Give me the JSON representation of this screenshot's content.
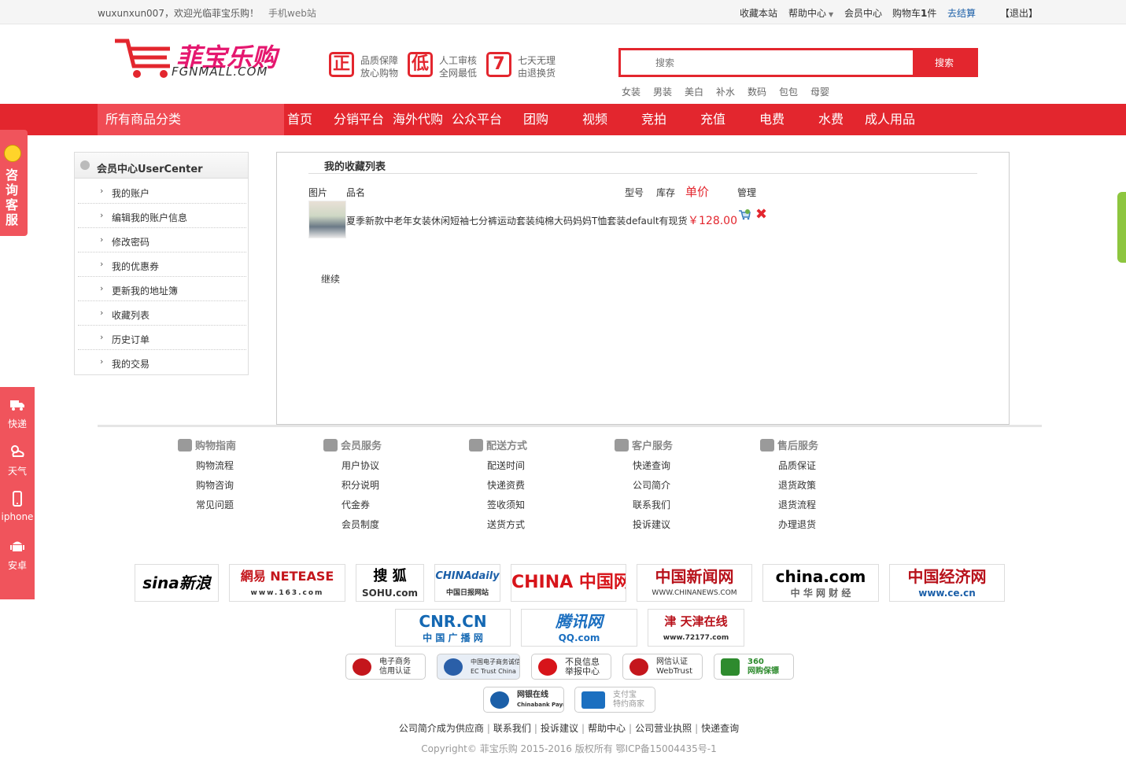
{
  "topbar": {
    "welcome": "wuxunxun007，欢迎光临菲宝乐购！",
    "mobile": "手机web站",
    "favorites": "收藏本站",
    "help": "帮助中心",
    "member": "会员中心",
    "cart_prefix": "购物车",
    "cart_count": "1",
    "cart_suffix": "件",
    "checkout": "去结算",
    "logout": "【退出】"
  },
  "logo": {
    "cn": "菲宝乐购",
    "en": "FGNMALL.COM"
  },
  "promises": [
    {
      "icon": "正",
      "line1": "品质保障",
      "line2": "放心购物"
    },
    {
      "icon": "低",
      "line1": "人工审核",
      "line2": "全网最低"
    },
    {
      "icon": "7",
      "line1": "七天无理",
      "line2": "由退换货"
    }
  ],
  "search": {
    "placeholder": "搜索",
    "button": "搜索"
  },
  "hotwords": [
    "女装",
    "男装",
    "美白",
    "补水",
    "数码",
    "包包",
    "母婴"
  ],
  "nav": {
    "all_categories": "所有商品分类",
    "items": [
      "首页",
      "分销平台",
      "海外代购",
      "公众平台",
      "团购",
      "视频",
      "竞拍",
      "充值",
      "电费",
      "水费",
      "成人用品"
    ]
  },
  "consult": {
    "label": "咨询客服"
  },
  "sidetools": [
    {
      "icon": "truck-icon",
      "label": "快递"
    },
    {
      "icon": "weather-icon",
      "label": "天气"
    },
    {
      "icon": "phone-icon",
      "label": "iphone"
    },
    {
      "icon": "android-icon",
      "label": "安卓"
    }
  ],
  "usercenter": {
    "title": "会员中心UserCenter",
    "items": [
      "我的账户",
      "编辑我的账户信息",
      "修改密码",
      "我的优惠券",
      "更新我的地址簿",
      "收藏列表",
      "历史订单",
      "我的交易"
    ]
  },
  "favorites": {
    "title": "我的收藏列表",
    "columns": {
      "image": "图片",
      "name": "品名",
      "model": "型号",
      "stock": "库存",
      "price": "单价",
      "manage": "管理"
    },
    "items": [
      {
        "name": "夏季新款中老年女装休闲短袖七分裤运动套装纯棉大码妈妈T恤套装default有现货",
        "price": "￥128.00"
      }
    ],
    "continue": "继续"
  },
  "footer": {
    "columns": [
      {
        "title": "购物指南",
        "links": [
          "购物流程",
          "购物咨询",
          "常见问题"
        ]
      },
      {
        "title": "会员服务",
        "links": [
          "用户协议",
          "积分说明",
          "代金券",
          "会员制度"
        ]
      },
      {
        "title": "配送方式",
        "links": [
          "配送时间",
          "快递资费",
          "签收须知",
          "送货方式"
        ]
      },
      {
        "title": "客户服务",
        "links": [
          "快递查询",
          "公司简介",
          "联系我们",
          "投诉建议"
        ]
      },
      {
        "title": "售后服务",
        "links": [
          "品质保证",
          "退货政策",
          "退货流程",
          "办理退货"
        ]
      }
    ],
    "media_logos": [
      {
        "main": "sina新浪",
        "sub": "",
        "color": "#000000"
      },
      {
        "main": "網易 NETEASE",
        "sub": "www.163.com",
        "color": "#c4161c"
      },
      {
        "main": "搜 狐",
        "sub": "SOHU.com",
        "color": "#000000"
      },
      {
        "main": "CHINAdaily",
        "sub": "中国日报网站",
        "color": "#1b5fa8"
      },
      {
        "main": "CHINA 中国网",
        "sub": "",
        "color": "#d7141a"
      },
      {
        "main": "中国新闻网",
        "sub": "WWW.CHINANEWS.COM",
        "color": "#b8121b"
      },
      {
        "main": "china.com",
        "sub": "中 华 网 财 经",
        "color": "#000000"
      },
      {
        "main": "中国经济网",
        "sub": "www.ce.cn",
        "color": "#b8121b"
      },
      {
        "main": "CNR.CN",
        "sub": "中 国 广 播 网",
        "color": "#1468b3"
      },
      {
        "main": "腾讯网",
        "sub": "QQ.com",
        "color": "#1b6fc0"
      },
      {
        "main": "津 天津在线",
        "sub": "www.72177.com",
        "color": "#b8121b"
      }
    ],
    "badges": [
      {
        "line1": "电子商务",
        "line2": "信用认证",
        "color": "#c4161c"
      },
      {
        "line1": "中国电子商务诚信单位",
        "line2": "EC Trust China",
        "color": "#2a5fa8"
      },
      {
        "line1": "不良信息",
        "line2": "举报中心",
        "color": "#d7141a"
      },
      {
        "line1": "网信认证",
        "line2": "WebTrust",
        "color": "#c4161c"
      },
      {
        "line1": "360",
        "line2": "网购保镖",
        "color": "#2e8b2e"
      },
      {
        "line1": "网银在线",
        "line2": "Chinabank Payment",
        "color": "#1b5fa8"
      },
      {
        "line1": "支付宝",
        "line2": "特约商家",
        "color": "#1b6fc0"
      }
    ],
    "bottom_links": [
      "公司简介",
      "成为供应商",
      "联系我们",
      "投诉建议",
      "帮助中心",
      "公司营业执照",
      "快递查询"
    ],
    "copyright": "Copyright© 菲宝乐购 2015-2016 版权所有 鄂ICP备15004435号-1"
  },
  "colors": {
    "brand_red": "#e3262e",
    "nav_highlight": "#f04b54",
    "green_flag": "#8dc63f"
  }
}
